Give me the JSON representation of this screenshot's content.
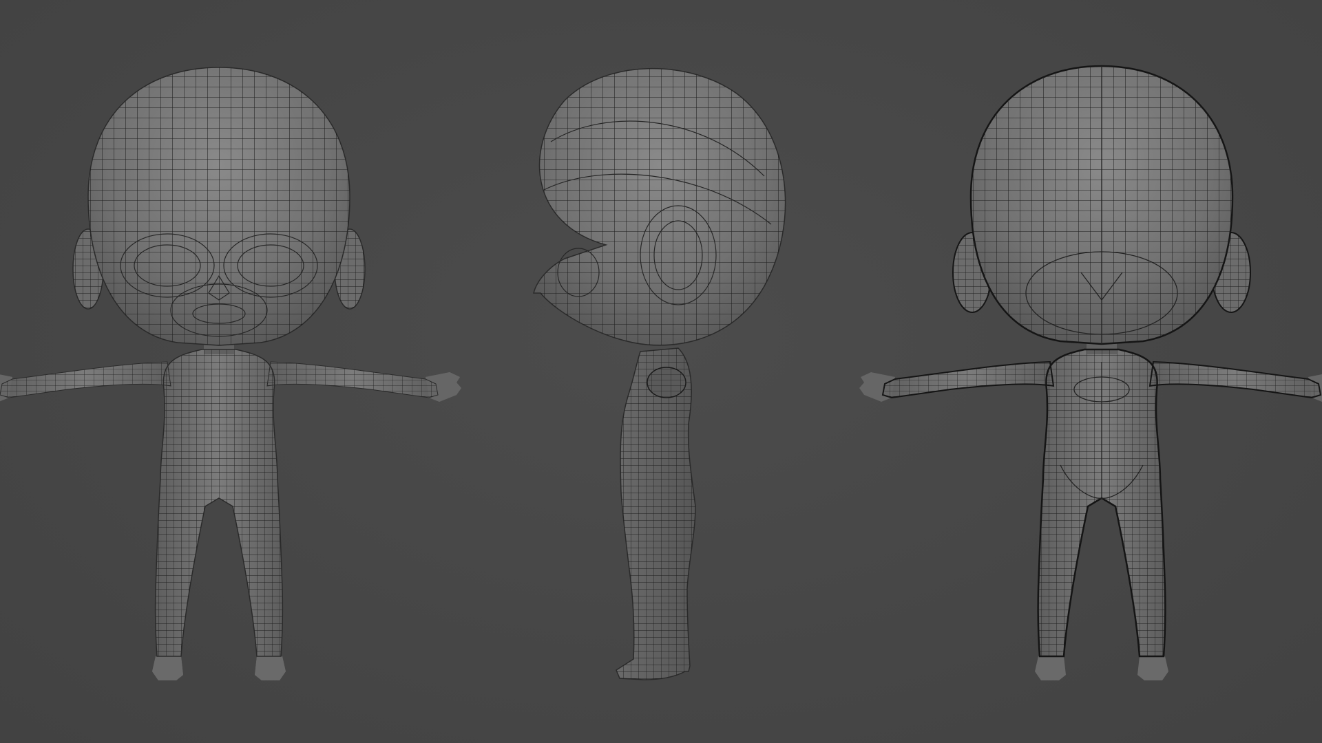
{
  "viewport": {
    "background_color": "#474747",
    "mesh_fill_color": "#6e6e6e",
    "mesh_highlight_color": "#8c8c8c",
    "wire_color": "#1c1c1c"
  },
  "models": [
    {
      "view": "front",
      "icon": "chibi-character-front-wireframe"
    },
    {
      "view": "side",
      "icon": "chibi-character-side-wireframe"
    },
    {
      "view": "back",
      "icon": "chibi-character-back-wireframe"
    }
  ]
}
